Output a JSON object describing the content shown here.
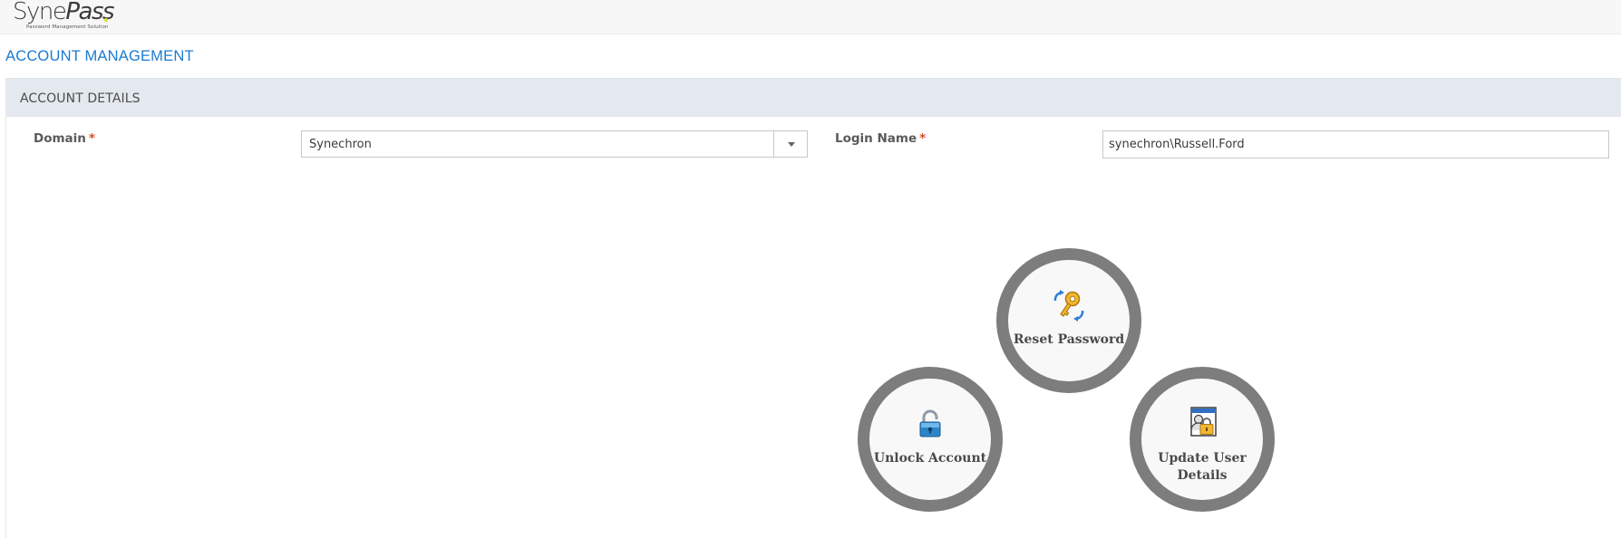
{
  "brand": {
    "logo_text_a": "Syne",
    "logo_text_b": "Pass",
    "logo_tagline": "Password Management Solution"
  },
  "page": {
    "title": "ACCOUNT MANAGEMENT"
  },
  "panel": {
    "title": "ACCOUNT DETAILS",
    "domain": {
      "label": "Domain",
      "required_mark": "*",
      "selected": "Synechron"
    },
    "login_name": {
      "label": "Login Name",
      "required_mark": "*",
      "value": "synechron\\Russell.Ford"
    }
  },
  "actions": {
    "reset_password": {
      "label": "Reset Password",
      "icon": "key-refresh-icon"
    },
    "unlock_account": {
      "label": "Unlock Account",
      "icon": "padlock-icon"
    },
    "update_user_details": {
      "label_line1": "Update User",
      "label_line2": "Details",
      "icon": "user-card-lock-icon"
    }
  },
  "colors": {
    "accent": "#1a7ad1",
    "required": "#e0482c",
    "panel_header": "#e4e9f0",
    "action_ring": "#7d7d7d"
  }
}
